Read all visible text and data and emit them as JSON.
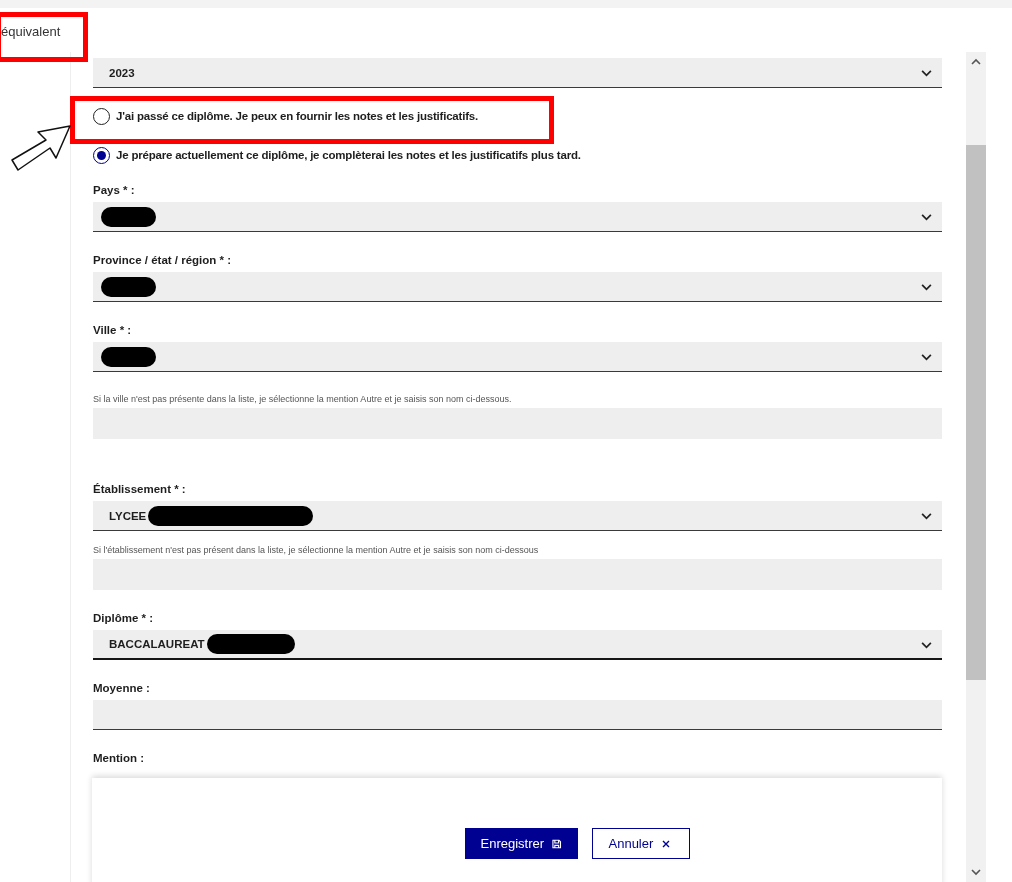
{
  "side_label": "équivalent",
  "year_select": {
    "value": "2023"
  },
  "status_options": [
    {
      "label": "J'ai passé ce diplôme. Je peux en fournir les notes et les justificatifs.",
      "selected": false
    },
    {
      "label": "Je prépare actuellement ce diplôme, je complèterai les notes et les justificatifs plus tard.",
      "selected": true
    }
  ],
  "fields": [
    {
      "kind": "select",
      "label": "Pays * :",
      "redacted": true
    },
    {
      "kind": "select",
      "label": "Province / état / région * :",
      "redacted": true
    },
    {
      "kind": "select",
      "label": "Ville * :",
      "redacted": true
    },
    {
      "kind": "input",
      "hint": "Si la ville n'est pas présente dans la liste, je sélectionne la mention Autre et je saisis son nom ci-dessous."
    },
    {
      "kind": "select",
      "label": "Établissement * :",
      "value": "LYCEE",
      "redacted": true
    },
    {
      "kind": "input",
      "hint": "Si l'établissement n'est pas présent dans la liste, je sélectionne la mention Autre et je saisis son nom ci-dessous"
    },
    {
      "kind": "select",
      "label": "Diplôme * :",
      "value": "BACCALAUREAT",
      "redacted": true
    },
    {
      "kind": "input",
      "label": "Moyenne :"
    },
    {
      "kind": "label",
      "label": "Mention :"
    }
  ],
  "buttons": [
    {
      "kind": "primary",
      "label": "Enregistrer"
    },
    {
      "kind": "secondary",
      "label": "Annuler"
    }
  ]
}
